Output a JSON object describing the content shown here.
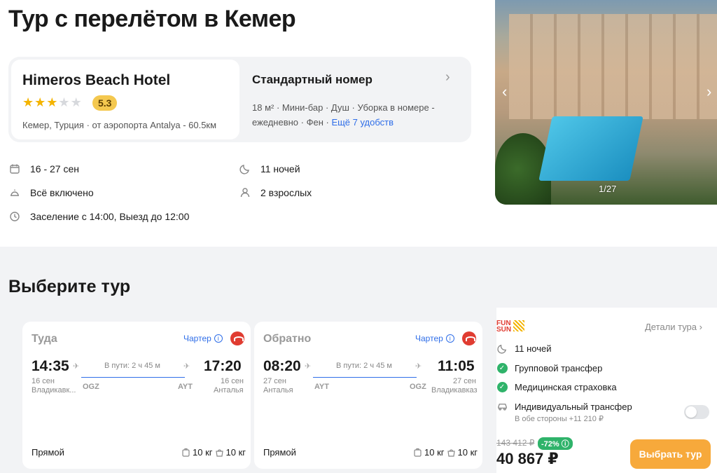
{
  "page": {
    "title": "Тур с перелётом в Кемер"
  },
  "hotel": {
    "name": "Himeros Beach Hotel",
    "stars": 3,
    "stars_max": 5,
    "rating": "5.3",
    "location": "Кемер, Турция · от аэропорта Antalya - 60.5км"
  },
  "room": {
    "title": "Стандартный номер",
    "amenities": "18 м² · Мини-бар · Душ · Уборка в номере - ежедневно · Фен · ",
    "more_link": "Ещё 7 удобств"
  },
  "summary": {
    "dates": "16 - 27 сен",
    "nights": "11 ночей",
    "meal": "Всё включено",
    "guests": "2 взрослых",
    "checkin": "Заселение с 14:00, Выезд до 12:00"
  },
  "gallery": {
    "counter": "1/27"
  },
  "section": {
    "title": "Выберите тур"
  },
  "outbound": {
    "title": "Туда",
    "charter": "Чартер",
    "dep_time": "14:35",
    "dep_date": "16 сен",
    "dep_city": "Владикавк...",
    "arr_time": "17:20",
    "arr_date": "16 сен",
    "arr_city": "Анталья",
    "duration": "В пути: 2 ч 45 м",
    "from_code": "OGZ",
    "to_code": "AYT",
    "type": "Прямой",
    "bag1": "10 кг",
    "bag2": "10 кг"
  },
  "inbound": {
    "title": "Обратно",
    "charter": "Чартер",
    "dep_time": "08:20",
    "dep_date": "27 сен",
    "dep_city": "Анталья",
    "arr_time": "11:05",
    "arr_date": "27 сен",
    "arr_city": "Владикавказ",
    "duration": "В пути: 2 ч 45 м",
    "from_code": "AYT",
    "to_code": "OGZ",
    "type": "Прямой",
    "bag1": "10 кг",
    "bag2": "10 кг"
  },
  "offer": {
    "operator_top": "FUN",
    "operator_bottom": "SUN",
    "details": "Детали тура",
    "nights": "11 ночей",
    "transfer": "Групповой трансфер",
    "insurance": "Медицинская страховка",
    "indiv_transfer": "Индивидуальный трансфер",
    "indiv_sub": "В обе стороны +11 210 ₽",
    "old_price": "143 412 ₽",
    "discount": "-72%",
    "price": "40 867 ₽",
    "buy": "Выбрать тур"
  },
  "colors": {
    "accent": "#f7a93b",
    "link": "#2f6ee8",
    "success": "#2fb36a",
    "rating": "#f4c84f"
  }
}
